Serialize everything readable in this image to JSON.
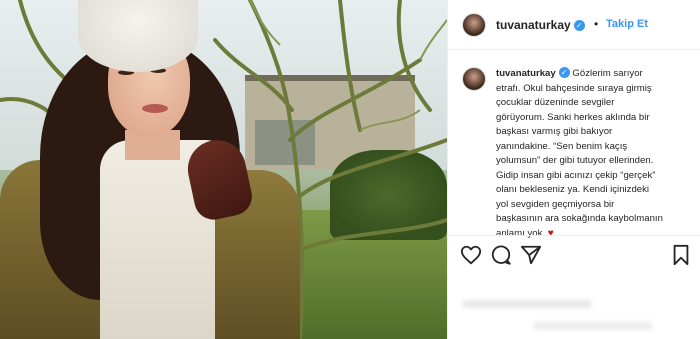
{
  "post": {
    "username": "tuvanaturkay",
    "follow_label": "Takip Et",
    "separator": "•",
    "caption_lines": [
      "Gözlerim sarıyor",
      "etrafı. Okul bahçesinde sıraya girmiş",
      "çocuklar düzeninde sevgiler",
      "görüyorum. Sanki herkes aklında bir",
      "başkası varmış gibi bakıyor",
      "yanındakine. “Sen benim kaçış",
      "yolumsun” der gibi tutuyor ellerinden.",
      "Gidip insan gibi acınızı çekip “gerçek”",
      "olanı bekleseniz ya. Kendi içinizdeki",
      "yol sevgiden geçmiyorsa bir",
      "başkasının ara sokağında kaybolmanın",
      "anlamı yok."
    ],
    "caption_emoji": "♥"
  },
  "icons": {
    "verified": "verified-badge-icon",
    "like": "heart-icon",
    "comment": "comment-icon",
    "share": "share-icon",
    "save": "bookmark-icon"
  },
  "colors": {
    "accent": "#3897f0",
    "text": "#262626",
    "border": "#efefef"
  }
}
